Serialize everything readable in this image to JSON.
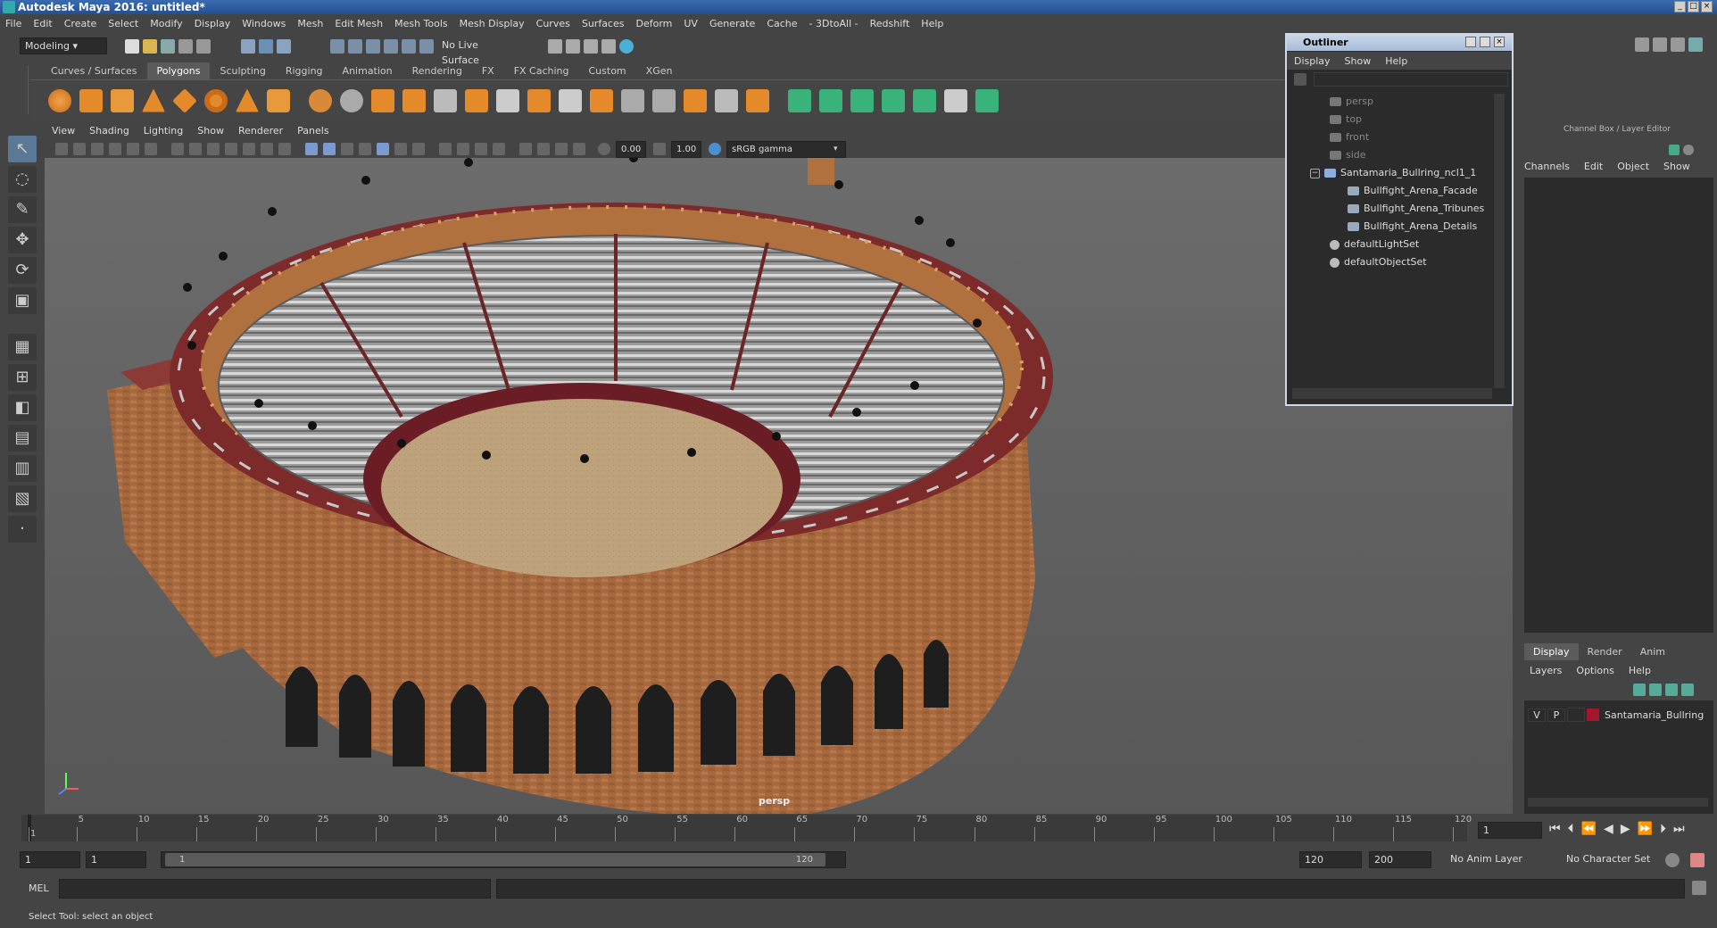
{
  "window": {
    "title": "Autodesk Maya 2016: untitled*"
  },
  "menus": [
    "File",
    "Edit",
    "Create",
    "Select",
    "Modify",
    "Display",
    "Windows",
    "Mesh",
    "Edit Mesh",
    "Mesh Tools",
    "Mesh Display",
    "Curves",
    "Surfaces",
    "Deform",
    "UV",
    "Generate",
    "Cache",
    "- 3DtoAll -",
    "Redshift",
    "Help"
  ],
  "status": {
    "mode": "Modeling",
    "live_surface": "No Live Surface"
  },
  "shelf": {
    "tabs": [
      "Curves / Surfaces",
      "Polygons",
      "Sculpting",
      "Rigging",
      "Animation",
      "Rendering",
      "FX",
      "FX Caching",
      "Custom",
      "XGen"
    ],
    "active": "Polygons"
  },
  "panel_menu": [
    "View",
    "Shading",
    "Lighting",
    "Show",
    "Renderer",
    "Panels"
  ],
  "viewport": {
    "exposure": "0.00",
    "gamma": "1.00",
    "color_space": "sRGB gamma",
    "camera_label": "persp"
  },
  "outliner": {
    "title": "Outliner",
    "menu": [
      "Display",
      "Show",
      "Help"
    ],
    "items": [
      {
        "label": "persp",
        "dim": true
      },
      {
        "label": "top",
        "dim": true
      },
      {
        "label": "front",
        "dim": true
      },
      {
        "label": "side",
        "dim": true
      },
      {
        "label": "Santamaria_Bullring_ncl1_1"
      },
      {
        "label": "Bullfight_Arena_Facade"
      },
      {
        "label": "Bullfight_Arena_Tribunes"
      },
      {
        "label": "Bullfight_Arena_Details"
      },
      {
        "label": "defaultLightSet"
      },
      {
        "label": "defaultObjectSet"
      }
    ]
  },
  "channel_box": {
    "title": "Channel Box / Layer Editor",
    "menu": [
      "Channels",
      "Edit",
      "Object",
      "Show"
    ],
    "layer_tabs": [
      "Display",
      "Render",
      "Anim"
    ],
    "layer_menu": [
      "Layers",
      "Options",
      "Help"
    ],
    "layer": {
      "v": "V",
      "p": "P",
      "name": "Santamaria_Bullring",
      "color": "#a3162e"
    }
  },
  "timeline": {
    "ticks": [
      "1",
      "5",
      "10",
      "15",
      "20",
      "25",
      "30",
      "35",
      "40",
      "45",
      "50",
      "55",
      "60",
      "65",
      "70",
      "75",
      "80",
      "85",
      "90",
      "95",
      "100",
      "105",
      "110",
      "115",
      "120"
    ],
    "current_frame": "1",
    "range_start": "1",
    "playback_start": "1",
    "slider_start": "1",
    "slider_end": "120",
    "playback_end": "120",
    "range_end": "200",
    "anim_layer": "No Anim Layer",
    "character_set": "No Character Set"
  },
  "cmdline": {
    "label": "MEL"
  },
  "helpline": {
    "text": "Select Tool: select an object"
  }
}
